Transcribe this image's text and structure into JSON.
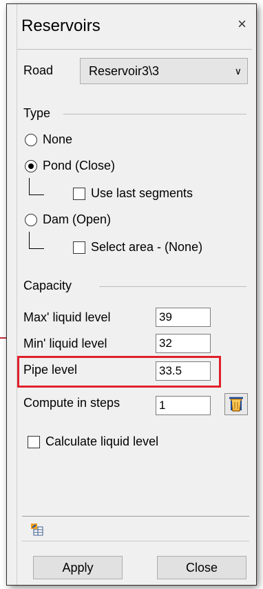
{
  "dialog": {
    "title": "Reservoirs",
    "close_symbol": "×"
  },
  "road": {
    "label": "Road",
    "selected": "Reservoir3\\3",
    "chevron": "∨"
  },
  "type": {
    "label": "Type",
    "options": [
      {
        "label": "None",
        "checked": false
      },
      {
        "label": "Pond (Close)",
        "checked": true
      },
      {
        "label": "Dam (Open)",
        "checked": false
      }
    ],
    "use_last_segments": "Use last segments",
    "select_area": "Select area  - (None)"
  },
  "capacity": {
    "label": "Capacity",
    "max_label": "Max' liquid level",
    "max_value": "39",
    "min_label": "Min' liquid level",
    "min_value": "32",
    "pipe_label": "Pipe level",
    "pipe_value": "33.5",
    "steps_label": "Compute in steps",
    "steps_value": "1",
    "calc_label": "Calculate liquid level"
  },
  "buttons": {
    "apply": "Apply",
    "close": "Close"
  },
  "icons": {
    "compute": "bucket-icon",
    "export": "export-table-icon"
  },
  "colors": {
    "highlight": "#e0202a",
    "accent_line": "#c0283a"
  }
}
